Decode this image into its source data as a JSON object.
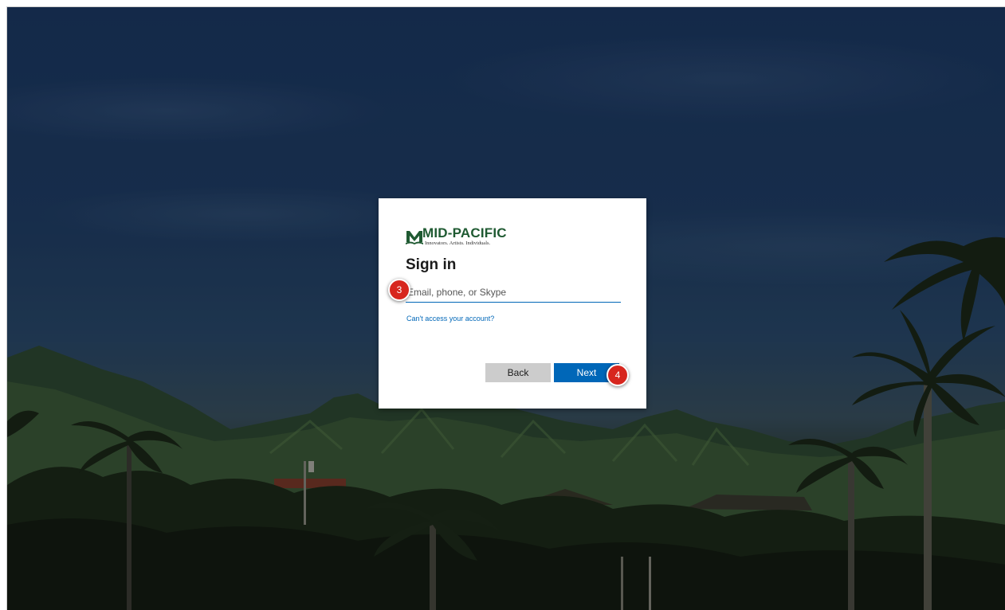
{
  "brand": {
    "name": "MID-PACIFIC",
    "tagline": "Innovators. Artists. Individuals.",
    "color": "#1f5a32"
  },
  "signin": {
    "title": "Sign in",
    "email_placeholder": "Email, phone, or Skype",
    "email_value": "",
    "help_link": "Can't access your account?",
    "back_label": "Back",
    "next_label": "Next"
  },
  "annotations": {
    "step_email": "3",
    "step_next": "4"
  },
  "colors": {
    "accent": "#0067b8",
    "back_button": "#cccccc",
    "badge": "#d7261e"
  }
}
